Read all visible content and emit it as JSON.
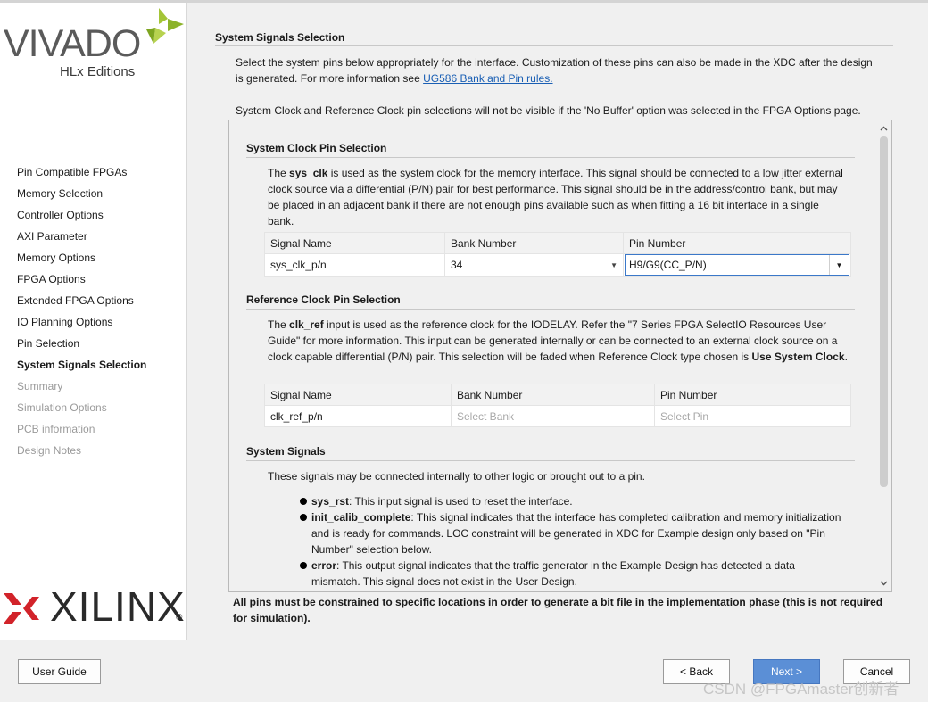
{
  "brand": {
    "vivado_word": "VIVADO",
    "vivado_sub": "HLx Editions",
    "xilinx_word": "XILINX",
    "xilinx_reg": "®"
  },
  "nav": [
    {
      "label": "Pin Compatible FPGAs",
      "state": "normal"
    },
    {
      "label": "Memory Selection",
      "state": "normal"
    },
    {
      "label": "Controller Options",
      "state": "normal"
    },
    {
      "label": "AXI Parameter",
      "state": "normal"
    },
    {
      "label": "Memory Options",
      "state": "normal"
    },
    {
      "label": "FPGA Options",
      "state": "normal"
    },
    {
      "label": "Extended FPGA Options",
      "state": "normal"
    },
    {
      "label": "IO Planning Options",
      "state": "normal"
    },
    {
      "label": "Pin Selection",
      "state": "normal"
    },
    {
      "label": "System Signals Selection",
      "state": "active"
    },
    {
      "label": "Summary",
      "state": "disabled"
    },
    {
      "label": "Simulation Options",
      "state": "disabled"
    },
    {
      "label": "PCB information",
      "state": "disabled"
    },
    {
      "label": "Design Notes",
      "state": "disabled"
    }
  ],
  "page": {
    "title": "System Signals Selection",
    "intro_text": "Select the system pins below appropriately for the interface. Customization of these pins can also be made in the XDC after the design is generated. For more information see ",
    "intro_link": "UG586 Bank and Pin rules.",
    "note": "System Clock and Reference Clock pin selections will not be visible if the 'No Buffer' option was selected in the FPGA Options page."
  },
  "sys_clock": {
    "title": "System Clock Pin Selection",
    "desc_pre": "The ",
    "desc_bold": "sys_clk",
    "desc_post": " is used as the system clock for the memory interface. This signal should be connected to a low jitter external clock source via a differential (P/N) pair for best performance. This signal should be in the address/control bank, but may be placed in an adjacent bank if there are not enough pins available such as when fitting a 16 bit interface in a single bank.",
    "columns": [
      "Signal Name",
      "Bank Number",
      "Pin Number"
    ],
    "row": {
      "signal": "sys_clk_p/n",
      "bank": "34",
      "pin": "H9/G9(CC_P/N)"
    }
  },
  "ref_clock": {
    "title": "Reference Clock Pin Selection",
    "desc_pre": "The ",
    "desc_bold": "clk_ref",
    "desc_mid": " input is used as the reference clock for the IODELAY. Refer the \"7 Series FPGA SelectIO Resources User Guide\" for more information. This input can be generated internally or can be connected to an external clock source on a clock capable differential (P/N) pair. This selection will be faded when Reference Clock type chosen is ",
    "desc_bold2": "Use System Clock",
    "desc_end": ".",
    "columns": [
      "Signal Name",
      "Bank Number",
      "Pin Number"
    ],
    "row": {
      "signal": "clk_ref_p/n",
      "bank": "Select Bank",
      "pin": "Select Pin"
    }
  },
  "sys_signals": {
    "title": "System Signals",
    "desc": "These signals may be connected internally to other logic or brought out to a pin.",
    "items": [
      {
        "name": "sys_rst",
        "text": ": This input signal is used to reset the interface."
      },
      {
        "name": "init_calib_complete",
        "text": ": This signal indicates that the interface has completed calibration and memory initialization and is ready for commands. LOC constraint will be generated in XDC for Example design only based on \"Pin Number\" selection below."
      },
      {
        "name": "error",
        "text": ": This output signal indicates that the traffic generator in the Example Design has detected a data mismatch. This signal does not exist in the User Design."
      }
    ]
  },
  "footer_note": "All pins must be constrained to specific locations in order to generate a bit file in the implementation phase (this is not required for simulation).",
  "buttons": {
    "user_guide": "User Guide",
    "back": "< Back",
    "next": "Next >",
    "cancel": "Cancel"
  },
  "watermark": "CSDN @FPGAmaster创新者",
  "colors": {
    "accent": "#5b8fd6",
    "link": "#1a5fb4",
    "xilinx_red": "#d2232a",
    "vivado_green": "#a4c537"
  }
}
